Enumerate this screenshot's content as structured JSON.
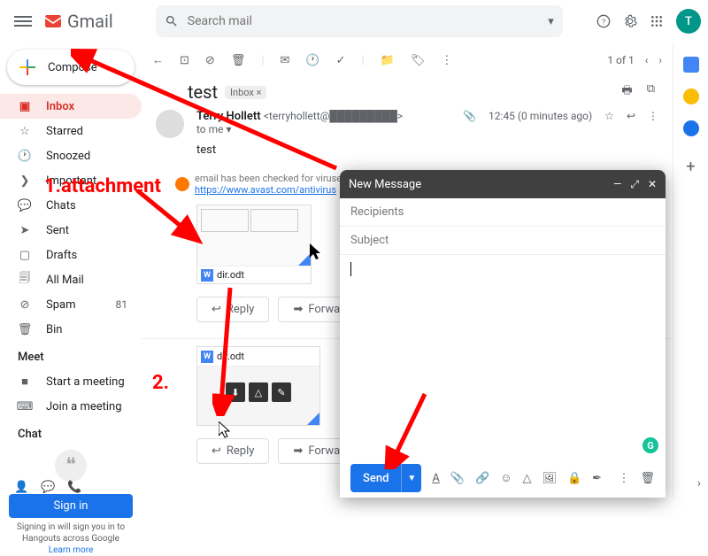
{
  "header": {
    "logo": "Gmail",
    "search_placeholder": "Search mail",
    "avatar_letter": "T"
  },
  "compose_label": "Compose",
  "nav": [
    {
      "icon": "inbox",
      "label": "Inbox",
      "active": true
    },
    {
      "icon": "star",
      "label": "Starred"
    },
    {
      "icon": "clock",
      "label": "Snoozed"
    },
    {
      "icon": "important",
      "label": "Important"
    },
    {
      "icon": "chat",
      "label": "Chats"
    },
    {
      "icon": "sent",
      "label": "Sent"
    },
    {
      "icon": "draft",
      "label": "Drafts"
    },
    {
      "icon": "allmail",
      "label": "All Mail"
    },
    {
      "icon": "spam",
      "label": "Spam",
      "count": "81"
    },
    {
      "icon": "bin",
      "label": "Bin"
    }
  ],
  "meet": {
    "header": "Meet",
    "start": "Start a meeting",
    "join": "Join a meeting"
  },
  "chat": {
    "header": "Chat"
  },
  "signin": {
    "button": "Sign in",
    "text": "Signing in will sign you in to Hangouts across Google",
    "learn": "Learn more"
  },
  "toolbar": {
    "counter": "1 of 1"
  },
  "email": {
    "subject": "test",
    "label_chip": "Inbox ×",
    "sender_name": "Terry Hollett",
    "sender_email": "<terryhollett@█████████>",
    "to": "to me ▾",
    "time": "12:45 (0 minutes ago)",
    "body": "test",
    "virus_text": "email has been checked for viruses by A",
    "virus_link": "https://www.avast.com/antivirus",
    "attachment_name": "dir.odt",
    "reply": "Reply",
    "forward": "Forward"
  },
  "compose_window": {
    "title": "New Message",
    "recipients": "Recipients",
    "subject": "Subject",
    "send": "Send"
  },
  "annotations": {
    "one": "1.attachment",
    "two": "2."
  }
}
